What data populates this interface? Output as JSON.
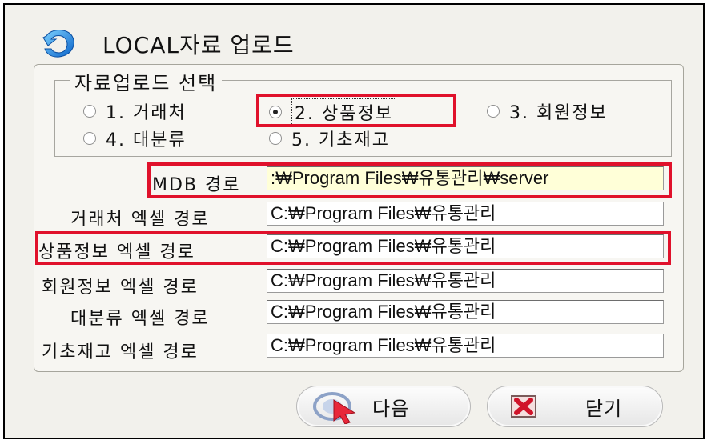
{
  "window": {
    "title": "LOCAL자료 업로드",
    "logo_icon": "blue-swirl-icon"
  },
  "selection": {
    "legend": "자료업로드 선택",
    "options": [
      {
        "label": "1. 거래처",
        "checked": false
      },
      {
        "label": "2. 상품정보",
        "checked": true
      },
      {
        "label": "3. 회원정보",
        "checked": false
      },
      {
        "label": "4. 대분류",
        "checked": false
      },
      {
        "label": "5. 기초재고",
        "checked": false
      }
    ]
  },
  "paths": {
    "mdb": {
      "label": "MDB 경로",
      "value": ":₩Program Files₩유통관리₩server"
    },
    "customer_excel": {
      "label": "거래처 엑셀 경로",
      "value": "C:₩Program Files₩유통관리"
    },
    "product_excel": {
      "label": "상품정보 엑셀 경로",
      "value": "C:₩Program Files₩유통관리"
    },
    "member_excel": {
      "label": "회원정보 엑셀 경로",
      "value": "C:₩Program Files₩유통관리"
    },
    "category_excel": {
      "label": "대분류 엑셀 경로",
      "value": "C:₩Program Files₩유통관리"
    },
    "stock_excel": {
      "label": "기초재고 엑셀 경로",
      "value": "C:₩Program Files₩유통관리"
    }
  },
  "buttons": {
    "next": {
      "label": "다음",
      "icon": "arrow-cursor-icon"
    },
    "close": {
      "label": "닫기",
      "icon": "red-x-icon"
    }
  },
  "colors": {
    "highlight": "#e0112b",
    "field_highlight": "#ffffd8"
  }
}
